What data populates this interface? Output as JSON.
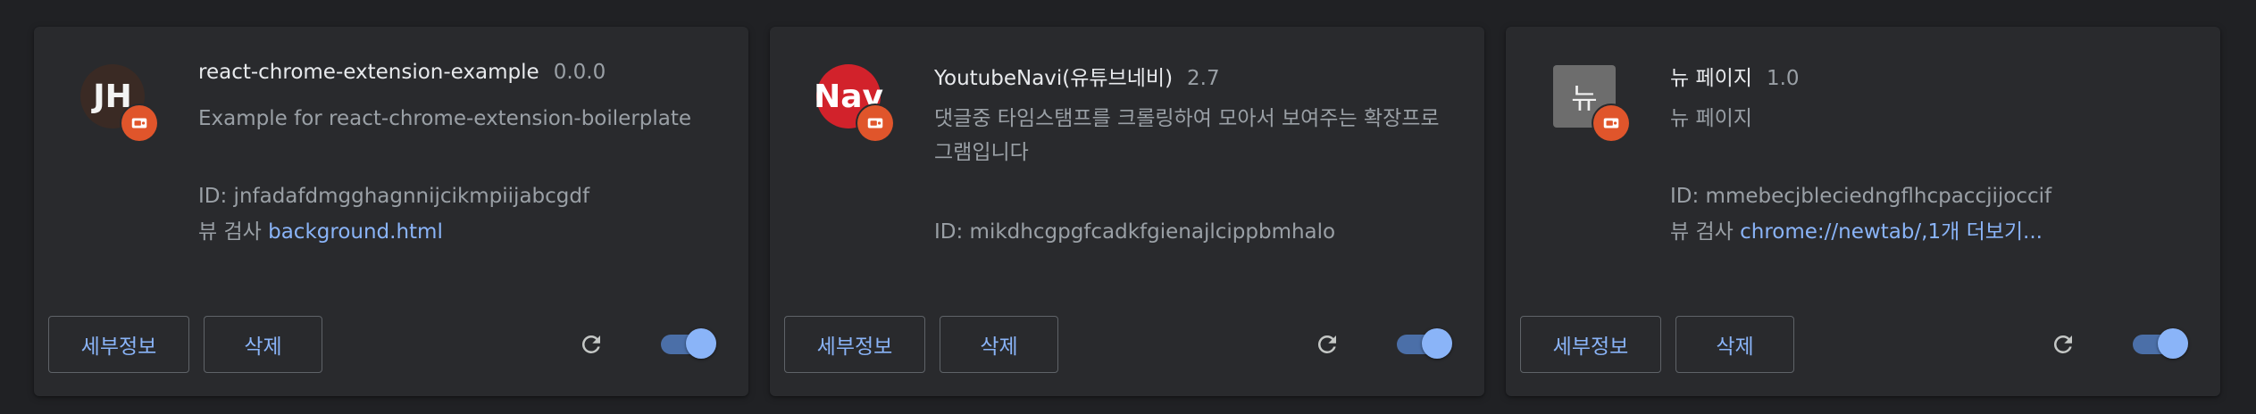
{
  "extensions": [
    {
      "avatar_text": "JH",
      "name": "react-chrome-extension-example",
      "version": "0.0.0",
      "description": "Example for react-chrome-extension-boilerplate",
      "id_text": "ID: jnfadafdmgghagnnijcikmpiijabcgdf",
      "inspect_label": "뷰 검사",
      "inspect_link": "background.html",
      "details_label": "세부정보",
      "remove_label": "삭제",
      "enabled": true
    },
    {
      "avatar_text": "Nav",
      "name": "YoutubeNavi(유튜브네비)",
      "version": "2.7",
      "description": "댓글중 타임스탬프를 크롤링하여 모아서 보여주는 확장프로그램입니다",
      "id_text": "ID: mikdhcgpgfcadkfgienajlcippbmhalo",
      "details_label": "세부정보",
      "remove_label": "삭제",
      "enabled": true
    },
    {
      "avatar_text": "뉴",
      "name": "뉴 페이지",
      "version": "1.0",
      "description": "뉴 페이지",
      "id_text": "ID: mmebecjbleciedngflhcpaccjijoccif",
      "inspect_label": "뷰 검사",
      "inspect_link": "chrome://newtab/,1개 더보기...",
      "details_label": "세부정보",
      "remove_label": "삭제",
      "enabled": true
    }
  ],
  "colors": {
    "background": "#202124",
    "card": "#292a2d",
    "link": "#8ab4f8",
    "badge": "#e0552b"
  },
  "icons": {
    "badge": "dev-mode-extension-icon",
    "reload": "reload-icon"
  }
}
